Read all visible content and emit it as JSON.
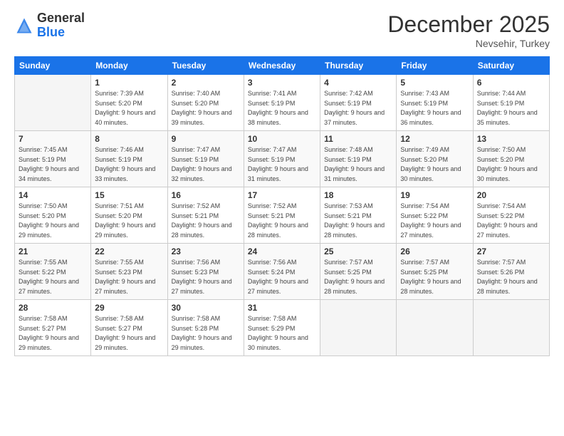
{
  "header": {
    "logo_general": "General",
    "logo_blue": "Blue",
    "month": "December 2025",
    "location": "Nevsehir, Turkey"
  },
  "days_of_week": [
    "Sunday",
    "Monday",
    "Tuesday",
    "Wednesday",
    "Thursday",
    "Friday",
    "Saturday"
  ],
  "weeks": [
    [
      {
        "day": "",
        "sunrise": "",
        "sunset": "",
        "daylight": ""
      },
      {
        "day": "1",
        "sunrise": "Sunrise: 7:39 AM",
        "sunset": "Sunset: 5:20 PM",
        "daylight": "Daylight: 9 hours and 40 minutes."
      },
      {
        "day": "2",
        "sunrise": "Sunrise: 7:40 AM",
        "sunset": "Sunset: 5:20 PM",
        "daylight": "Daylight: 9 hours and 39 minutes."
      },
      {
        "day": "3",
        "sunrise": "Sunrise: 7:41 AM",
        "sunset": "Sunset: 5:19 PM",
        "daylight": "Daylight: 9 hours and 38 minutes."
      },
      {
        "day": "4",
        "sunrise": "Sunrise: 7:42 AM",
        "sunset": "Sunset: 5:19 PM",
        "daylight": "Daylight: 9 hours and 37 minutes."
      },
      {
        "day": "5",
        "sunrise": "Sunrise: 7:43 AM",
        "sunset": "Sunset: 5:19 PM",
        "daylight": "Daylight: 9 hours and 36 minutes."
      },
      {
        "day": "6",
        "sunrise": "Sunrise: 7:44 AM",
        "sunset": "Sunset: 5:19 PM",
        "daylight": "Daylight: 9 hours and 35 minutes."
      }
    ],
    [
      {
        "day": "7",
        "sunrise": "Sunrise: 7:45 AM",
        "sunset": "Sunset: 5:19 PM",
        "daylight": "Daylight: 9 hours and 34 minutes."
      },
      {
        "day": "8",
        "sunrise": "Sunrise: 7:46 AM",
        "sunset": "Sunset: 5:19 PM",
        "daylight": "Daylight: 9 hours and 33 minutes."
      },
      {
        "day": "9",
        "sunrise": "Sunrise: 7:47 AM",
        "sunset": "Sunset: 5:19 PM",
        "daylight": "Daylight: 9 hours and 32 minutes."
      },
      {
        "day": "10",
        "sunrise": "Sunrise: 7:47 AM",
        "sunset": "Sunset: 5:19 PM",
        "daylight": "Daylight: 9 hours and 31 minutes."
      },
      {
        "day": "11",
        "sunrise": "Sunrise: 7:48 AM",
        "sunset": "Sunset: 5:19 PM",
        "daylight": "Daylight: 9 hours and 31 minutes."
      },
      {
        "day": "12",
        "sunrise": "Sunrise: 7:49 AM",
        "sunset": "Sunset: 5:20 PM",
        "daylight": "Daylight: 9 hours and 30 minutes."
      },
      {
        "day": "13",
        "sunrise": "Sunrise: 7:50 AM",
        "sunset": "Sunset: 5:20 PM",
        "daylight": "Daylight: 9 hours and 30 minutes."
      }
    ],
    [
      {
        "day": "14",
        "sunrise": "Sunrise: 7:50 AM",
        "sunset": "Sunset: 5:20 PM",
        "daylight": "Daylight: 9 hours and 29 minutes."
      },
      {
        "day": "15",
        "sunrise": "Sunrise: 7:51 AM",
        "sunset": "Sunset: 5:20 PM",
        "daylight": "Daylight: 9 hours and 29 minutes."
      },
      {
        "day": "16",
        "sunrise": "Sunrise: 7:52 AM",
        "sunset": "Sunset: 5:21 PM",
        "daylight": "Daylight: 9 hours and 28 minutes."
      },
      {
        "day": "17",
        "sunrise": "Sunrise: 7:52 AM",
        "sunset": "Sunset: 5:21 PM",
        "daylight": "Daylight: 9 hours and 28 minutes."
      },
      {
        "day": "18",
        "sunrise": "Sunrise: 7:53 AM",
        "sunset": "Sunset: 5:21 PM",
        "daylight": "Daylight: 9 hours and 28 minutes."
      },
      {
        "day": "19",
        "sunrise": "Sunrise: 7:54 AM",
        "sunset": "Sunset: 5:22 PM",
        "daylight": "Daylight: 9 hours and 27 minutes."
      },
      {
        "day": "20",
        "sunrise": "Sunrise: 7:54 AM",
        "sunset": "Sunset: 5:22 PM",
        "daylight": "Daylight: 9 hours and 27 minutes."
      }
    ],
    [
      {
        "day": "21",
        "sunrise": "Sunrise: 7:55 AM",
        "sunset": "Sunset: 5:22 PM",
        "daylight": "Daylight: 9 hours and 27 minutes."
      },
      {
        "day": "22",
        "sunrise": "Sunrise: 7:55 AM",
        "sunset": "Sunset: 5:23 PM",
        "daylight": "Daylight: 9 hours and 27 minutes."
      },
      {
        "day": "23",
        "sunrise": "Sunrise: 7:56 AM",
        "sunset": "Sunset: 5:23 PM",
        "daylight": "Daylight: 9 hours and 27 minutes."
      },
      {
        "day": "24",
        "sunrise": "Sunrise: 7:56 AM",
        "sunset": "Sunset: 5:24 PM",
        "daylight": "Daylight: 9 hours and 27 minutes."
      },
      {
        "day": "25",
        "sunrise": "Sunrise: 7:57 AM",
        "sunset": "Sunset: 5:25 PM",
        "daylight": "Daylight: 9 hours and 28 minutes."
      },
      {
        "day": "26",
        "sunrise": "Sunrise: 7:57 AM",
        "sunset": "Sunset: 5:25 PM",
        "daylight": "Daylight: 9 hours and 28 minutes."
      },
      {
        "day": "27",
        "sunrise": "Sunrise: 7:57 AM",
        "sunset": "Sunset: 5:26 PM",
        "daylight": "Daylight: 9 hours and 28 minutes."
      }
    ],
    [
      {
        "day": "28",
        "sunrise": "Sunrise: 7:58 AM",
        "sunset": "Sunset: 5:27 PM",
        "daylight": "Daylight: 9 hours and 29 minutes."
      },
      {
        "day": "29",
        "sunrise": "Sunrise: 7:58 AM",
        "sunset": "Sunset: 5:27 PM",
        "daylight": "Daylight: 9 hours and 29 minutes."
      },
      {
        "day": "30",
        "sunrise": "Sunrise: 7:58 AM",
        "sunset": "Sunset: 5:28 PM",
        "daylight": "Daylight: 9 hours and 29 minutes."
      },
      {
        "day": "31",
        "sunrise": "Sunrise: 7:58 AM",
        "sunset": "Sunset: 5:29 PM",
        "daylight": "Daylight: 9 hours and 30 minutes."
      },
      {
        "day": "",
        "sunrise": "",
        "sunset": "",
        "daylight": ""
      },
      {
        "day": "",
        "sunrise": "",
        "sunset": "",
        "daylight": ""
      },
      {
        "day": "",
        "sunrise": "",
        "sunset": "",
        "daylight": ""
      }
    ]
  ]
}
